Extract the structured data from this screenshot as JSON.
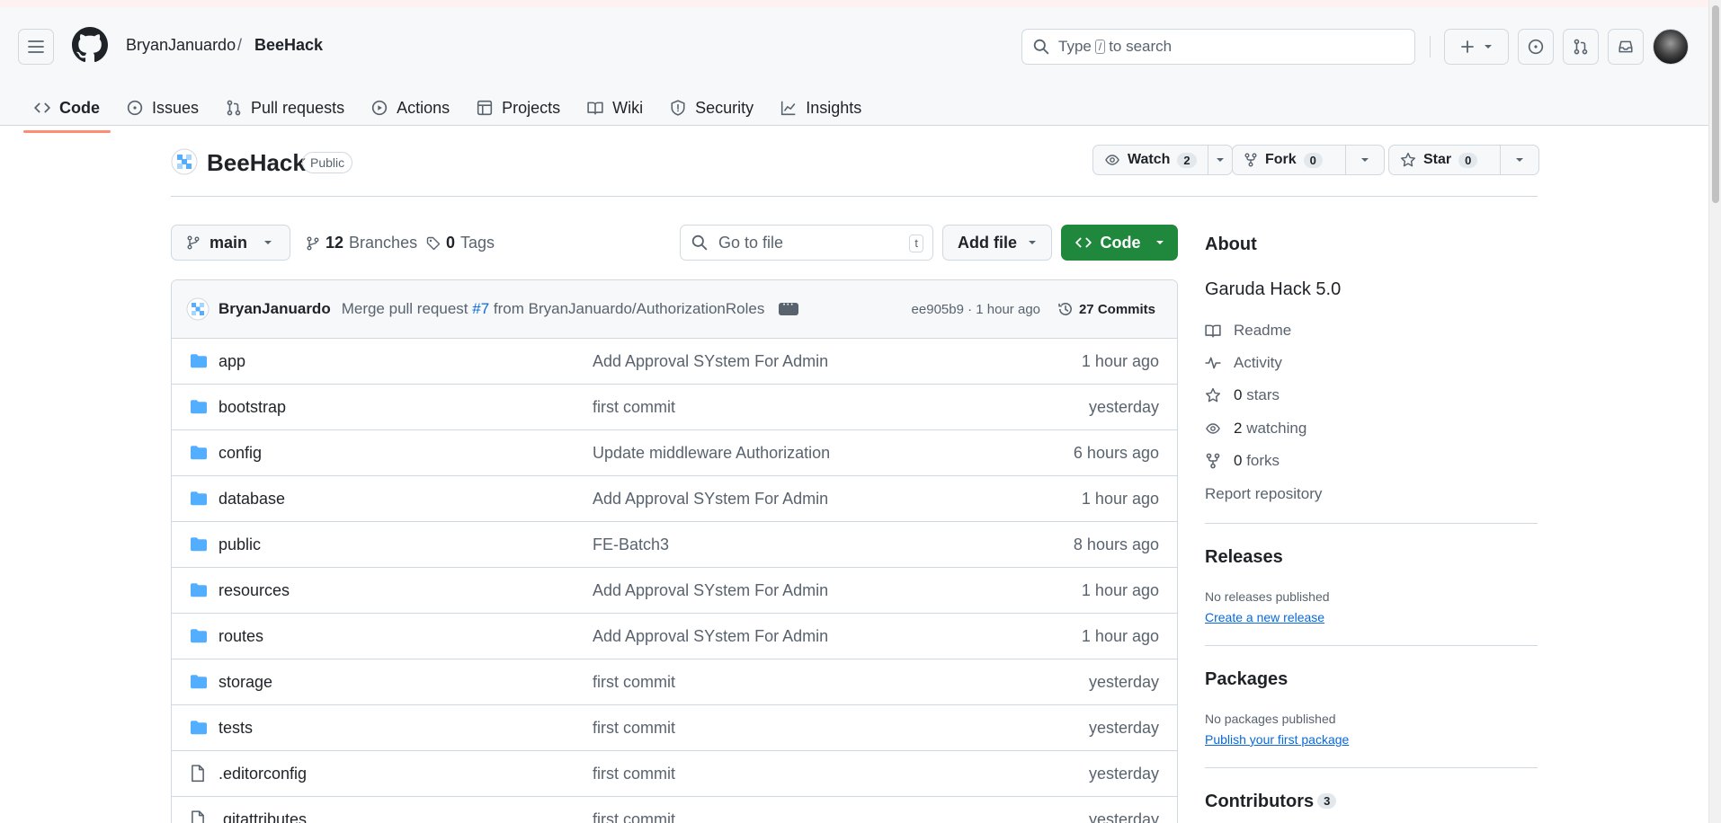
{
  "header": {
    "owner": "BryanJanuardo",
    "separator": "/",
    "repo": "BeeHack",
    "search_before": "Type",
    "search_key": "/",
    "search_after": "to search"
  },
  "nav": [
    {
      "label": "Code",
      "icon": "code-icon"
    },
    {
      "label": "Issues",
      "icon": "issue-icon"
    },
    {
      "label": "Pull requests",
      "icon": "pull-request-icon"
    },
    {
      "label": "Actions",
      "icon": "actions-icon"
    },
    {
      "label": "Projects",
      "icon": "projects-icon"
    },
    {
      "label": "Wiki",
      "icon": "wiki-icon"
    },
    {
      "label": "Security",
      "icon": "shield-icon"
    },
    {
      "label": "Insights",
      "icon": "graph-icon"
    }
  ],
  "repo": {
    "name": "BeeHack",
    "visibility": "Public",
    "watch_label": "Watch",
    "watch_count": "2",
    "fork_label": "Fork",
    "fork_count": "0",
    "star_label": "Star",
    "star_count": "0"
  },
  "toolbar": {
    "branch": "main",
    "branches_count": "12",
    "branches_label": "Branches",
    "tags_count": "0",
    "tags_label": "Tags",
    "gofile_placeholder": "Go to file",
    "gofile_key": "t",
    "addfile_label": "Add file",
    "code_label": "Code"
  },
  "commit": {
    "author": "BryanJanuardo",
    "msg_before": "Merge pull request",
    "pr_link": "#7",
    "msg_after": "from BryanJanuardo/AuthorizationRoles",
    "sha_time": "ee905b9 · 1 hour ago",
    "commits_label": "27 Commits"
  },
  "files": [
    {
      "name": "app",
      "type": "dir",
      "message": "Add Approval SYstem For Admin",
      "date": "1 hour ago"
    },
    {
      "name": "bootstrap",
      "type": "dir",
      "message": "first commit",
      "date": "yesterday"
    },
    {
      "name": "config",
      "type": "dir",
      "message": "Update middleware Authorization",
      "date": "6 hours ago"
    },
    {
      "name": "database",
      "type": "dir",
      "message": "Add Approval SYstem For Admin",
      "date": "1 hour ago"
    },
    {
      "name": "public",
      "type": "dir",
      "message": "FE-Batch3",
      "date": "8 hours ago"
    },
    {
      "name": "resources",
      "type": "dir",
      "message": "Add Approval SYstem For Admin",
      "date": "1 hour ago"
    },
    {
      "name": "routes",
      "type": "dir",
      "message": "Add Approval SYstem For Admin",
      "date": "1 hour ago"
    },
    {
      "name": "storage",
      "type": "dir",
      "message": "first commit",
      "date": "yesterday"
    },
    {
      "name": "tests",
      "type": "dir",
      "message": "first commit",
      "date": "yesterday"
    },
    {
      "name": ".editorconfig",
      "type": "file",
      "message": "first commit",
      "date": "yesterday"
    },
    {
      "name": ".gitattributes",
      "type": "file",
      "message": "first commit",
      "date": "yesterday"
    }
  ],
  "about": {
    "heading": "About",
    "description": "Garuda Hack 5.0",
    "readme": "Readme",
    "activity": "Activity",
    "stars_count": "0",
    "stars_label": "stars",
    "watching_count": "2",
    "watching_label": "watching",
    "forks_count": "0",
    "forks_label": "forks",
    "report": "Report repository"
  },
  "releases": {
    "heading": "Releases",
    "empty": "No releases published",
    "link": "Create a new release"
  },
  "packages": {
    "heading": "Packages",
    "empty": "No packages published",
    "link": "Publish your first package"
  },
  "contributors": {
    "heading": "Contributors",
    "count": "3"
  },
  "colors": {
    "accent_underline": "#fd8c73",
    "primary_button": "#1f883d",
    "link": "#0969da",
    "folder_icon": "#54aeff"
  }
}
